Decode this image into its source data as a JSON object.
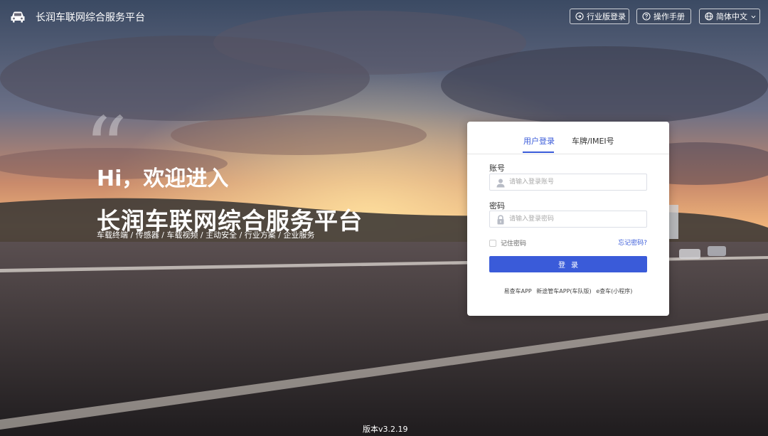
{
  "header": {
    "title": "长润车联网综合服务平台",
    "industry_login": "行业版登录",
    "manual": "操作手册",
    "language": "简体中文"
  },
  "hero": {
    "greeting": "Hi，欢迎进入",
    "title": "长润车联网综合服务平台",
    "subtitle": "车载终端 / 传感器 / 车载视频 / 主动安全 / 行业方案 / 企业服务"
  },
  "login": {
    "tabs": [
      "用户登录",
      "车牌/IMEI号"
    ],
    "account_label": "账号",
    "account_placeholder": "请输入登录账号",
    "password_label": "密码",
    "password_placeholder": "请输入登录密码",
    "remember": "记住密码",
    "forgot": "忘记密码?",
    "submit": "登录",
    "apps": [
      "易查车APP",
      "新途管车APP(车队版)",
      "e查车(小程序)"
    ]
  },
  "footer": {
    "version": "版本v3.2.19"
  },
  "colors": {
    "accent": "#3a5bd9"
  },
  "icons": [
    "car-icon",
    "login-icon",
    "help-circle-icon",
    "globe-icon",
    "chevron-down-icon",
    "user-icon",
    "lock-icon"
  ]
}
